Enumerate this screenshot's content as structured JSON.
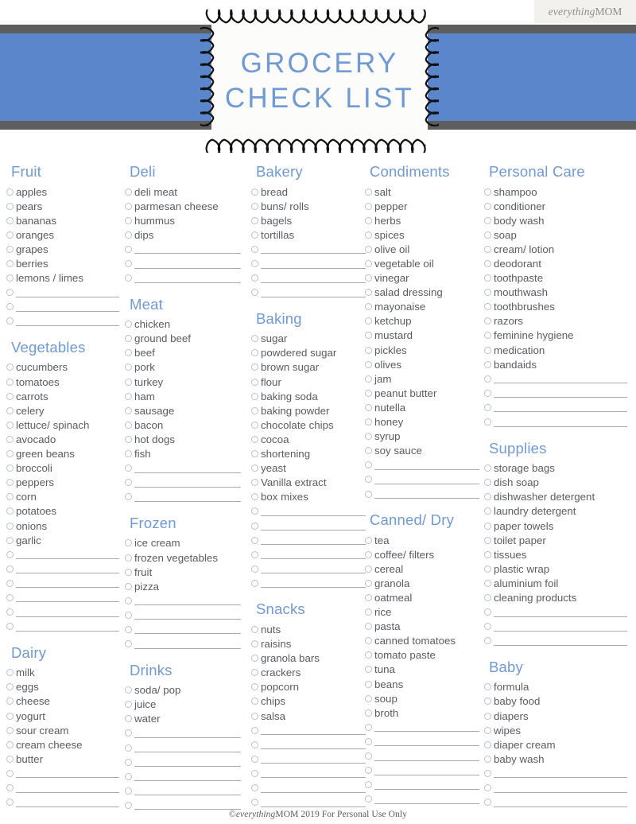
{
  "brand": {
    "prefix": "everything",
    "suffix": "MOM"
  },
  "title": {
    "line1": "GROCERY",
    "line2": "CHECK LIST"
  },
  "colors": {
    "banner_blue": "#5b86cb",
    "stripe_gray": "#5e5e5e",
    "heading_blue": "#6f9ad6",
    "item_text": "#595c61",
    "checkbox_border": "#b9c2cb",
    "brand_panel": "#f2f1ee"
  },
  "footer": {
    "copyright_symbol": "©",
    "brand_italic": "everything",
    "brand_bold": "MOM",
    "rest": " 2019 For Personal Use Only"
  },
  "columns": [
    {
      "id": "column-1",
      "categories": [
        {
          "name": "Fruit",
          "items": [
            "apples",
            "pears",
            "bananas",
            "oranges",
            "grapes",
            "berries",
            "lemons / limes"
          ],
          "blanks": 3
        },
        {
          "name": "Vegetables",
          "items": [
            "cucumbers",
            "tomatoes",
            "carrots",
            "celery",
            "lettuce/ spinach",
            "avocado",
            "green beans",
            "broccoli",
            "peppers",
            "corn",
            "potatoes",
            "onions",
            "garlic"
          ],
          "blanks": 6
        },
        {
          "name": "Dairy",
          "items": [
            "milk",
            "eggs",
            "cheese",
            "yogurt",
            "sour cream",
            "cream cheese",
            "butter"
          ],
          "blanks": 3
        }
      ]
    },
    {
      "id": "column-2",
      "categories": [
        {
          "name": "Deli",
          "items": [
            "deli meat",
            "parmesan cheese",
            "hummus",
            "dips"
          ],
          "blanks": 3
        },
        {
          "name": "Meat",
          "items": [
            "chicken",
            "ground beef",
            "beef",
            "pork",
            "turkey",
            "ham",
            "sausage",
            "bacon",
            "hot dogs",
            "fish"
          ],
          "blanks": 3
        },
        {
          "name": "Frozen",
          "items": [
            "ice cream",
            "frozen vegetables",
            "fruit",
            "pizza"
          ],
          "blanks": 4
        },
        {
          "name": "Drinks",
          "items": [
            "soda/ pop",
            "juice",
            "water"
          ],
          "blanks": 6
        }
      ]
    },
    {
      "id": "column-3",
      "categories": [
        {
          "name": "Bakery",
          "items": [
            "bread",
            "buns/ rolls",
            "bagels",
            "tortillas"
          ],
          "blanks": 4
        },
        {
          "name": "Baking",
          "items": [
            "sugar",
            "powdered sugar",
            "brown sugar",
            "flour",
            "baking soda",
            "baking powder",
            "chocolate chips",
            "cocoa",
            "shortening",
            "yeast",
            "Vanilla extract",
            "box mixes"
          ],
          "blanks": 6
        },
        {
          "name": "Snacks",
          "items": [
            "nuts",
            "raisins",
            "granola bars",
            "crackers",
            "popcorn",
            "chips",
            "salsa"
          ],
          "blanks": 6
        }
      ]
    },
    {
      "id": "column-4",
      "categories": [
        {
          "name": "Condiments",
          "items": [
            "salt",
            "pepper",
            "herbs",
            "spices",
            "olive oil",
            "vegetable oil",
            "vinegar",
            "salad dressing",
            "mayonaise",
            "ketchup",
            "mustard",
            "pickles",
            "olives",
            "jam",
            "peanut butter",
            "nutella",
            "honey",
            "syrup",
            "soy sauce"
          ],
          "blanks": 3
        },
        {
          "name": "Canned/ Dry",
          "items": [
            "tea",
            "coffee/ filters",
            "cereal",
            "granola",
            "oatmeal",
            "rice",
            "pasta",
            "canned tomatoes",
            "tomato paste",
            "tuna",
            "beans",
            "soup",
            "broth"
          ],
          "blanks": 6
        }
      ]
    },
    {
      "id": "column-5",
      "categories": [
        {
          "name": "Personal Care",
          "items": [
            "shampoo",
            "conditioner",
            "body wash",
            "soap",
            "cream/ lotion",
            "deodorant",
            "toothpaste",
            "mouthwash",
            "toothbrushes",
            "razors",
            "feminine hygiene",
            "medication",
            "bandaids"
          ],
          "blanks": 4
        },
        {
          "name": "Supplies",
          "items": [
            "storage bags",
            "dish soap",
            "dishwasher detergent",
            "laundry detergent",
            "paper towels",
            "toilet paper",
            "tissues",
            "plastic wrap",
            "aluminium foil",
            "cleaning products"
          ],
          "blanks": 3
        },
        {
          "name": "Baby",
          "items": [
            "formula",
            "baby food",
            "diapers",
            "wipes",
            "diaper cream",
            "baby wash"
          ],
          "blanks": 3
        }
      ]
    }
  ]
}
